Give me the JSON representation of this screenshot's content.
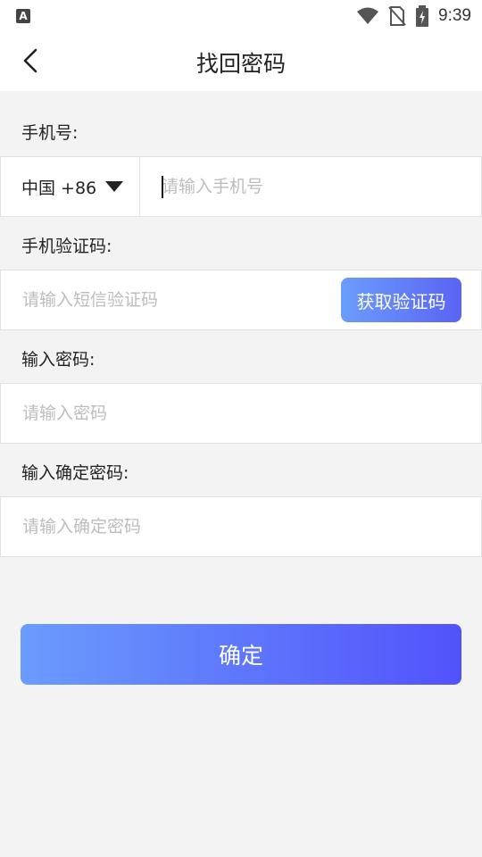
{
  "status_bar": {
    "app_icon_letter": "A",
    "time": "9:39",
    "icons": [
      "wifi-icon",
      "no-sim-icon",
      "battery-charging-icon"
    ]
  },
  "header": {
    "title": "找回密码",
    "back_icon": "chevron-left-icon"
  },
  "phone": {
    "label": "手机号:",
    "country_code": "中国 +86",
    "placeholder": "请输入手机号",
    "value": ""
  },
  "sms_code": {
    "label": "手机验证码:",
    "placeholder": "请输入短信验证码",
    "button_label": "获取验证码"
  },
  "password": {
    "label": "输入密码:",
    "placeholder": "请输入密码"
  },
  "confirm_password": {
    "label": "输入确定密码:",
    "placeholder": "请输入确定密码"
  },
  "submit": {
    "label": "确定"
  },
  "colors": {
    "background": "#f3f3f3",
    "button_gradient_start": "#6a9cfc",
    "button_gradient_end": "#5252fb",
    "placeholder": "#bdbdbd"
  }
}
